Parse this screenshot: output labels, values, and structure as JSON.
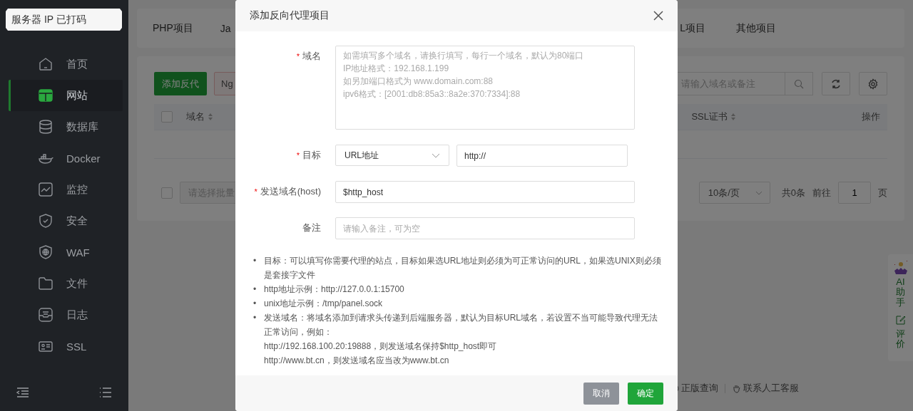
{
  "notice": "服务器 IP 已打码",
  "sidebar": {
    "items": [
      {
        "label": "首页",
        "selected": false
      },
      {
        "label": "网站",
        "selected": true
      },
      {
        "label": "数据库",
        "selected": false
      },
      {
        "label": "Docker",
        "selected": false
      },
      {
        "label": "监控",
        "selected": false
      },
      {
        "label": "安全",
        "selected": false
      },
      {
        "label": "WAF",
        "selected": false
      },
      {
        "label": "文件",
        "selected": false
      },
      {
        "label": "日志",
        "selected": false
      },
      {
        "label": "SSL",
        "selected": false
      }
    ]
  },
  "tabs": [
    {
      "label": "PHP项目"
    },
    {
      "label": "Ja"
    },
    {
      "label": "L项目"
    },
    {
      "label": "其他项目"
    }
  ],
  "toolbar": {
    "add_button": "添加反代",
    "second_button": "Ng",
    "search": {
      "placeholder": "请输入域名或备注"
    }
  },
  "table": {
    "checked": false,
    "columns": [
      "域名",
      "SSL证书",
      "操作"
    ]
  },
  "batch": {
    "checked": false,
    "placeholder": "请选择批量"
  },
  "pagination": {
    "page_size": "10条/页",
    "total": "共0条",
    "goto": "前往",
    "page": "1",
    "unit": "页"
  },
  "footer_links": [
    "正版查询",
    "联系人工客服"
  ],
  "assistant": {
    "ai": "AI",
    "label": "助手",
    "review": "评价"
  },
  "dialog": {
    "title": "添加反向代理项目",
    "fields": [
      {
        "kind": "textarea",
        "label": "域名",
        "marker": "*",
        "placeholder": "如需填写多个域名，请换行填写，每行一个域名，默认为80端口\nIP地址格式：192.168.1.199\n如另加端口格式为 www.domain.com:88\nipv6格式：[2001:db8:85a3::8a2e:370:7334]:88"
      },
      {
        "kind": "target",
        "label": "目标",
        "marker": "*",
        "select": "URL地址",
        "value": "http://"
      },
      {
        "kind": "input",
        "label": "发送域名(host)",
        "marker": "*",
        "value": "$http_host"
      },
      {
        "kind": "input",
        "label": "备注",
        "placeholder": "请输入备注，可为空"
      }
    ],
    "notes": [
      {
        "bullet": "•",
        "text": "目标：可以填写你需要代理的站点，目标如果选URL地址则必须为可正常访问的URL，如果选UNIX则必须是套接字文件"
      },
      {
        "bullet": "•",
        "text": "http地址示例：http://127.0.0.1:15700"
      },
      {
        "bullet": "•",
        "text": "unix地址示例：/tmp/panel.sock"
      },
      {
        "bullet": "•",
        "text": "发送域名：将域名添加到请求头传递到后端服务器，默认为目标URL域名，若设置不当可能导致代理无法正常访问，例如：",
        "lines": [
          "http://192.168.100.20:19888，则发送域名保持$http_host即可",
          "http://www.bt.cn，则发送域名应当改为www.bt.cn"
        ]
      }
    ],
    "buttons": [
      {
        "label": "取消",
        "kind": "secondary"
      },
      {
        "label": "确定",
        "kind": "primary"
      }
    ]
  }
}
